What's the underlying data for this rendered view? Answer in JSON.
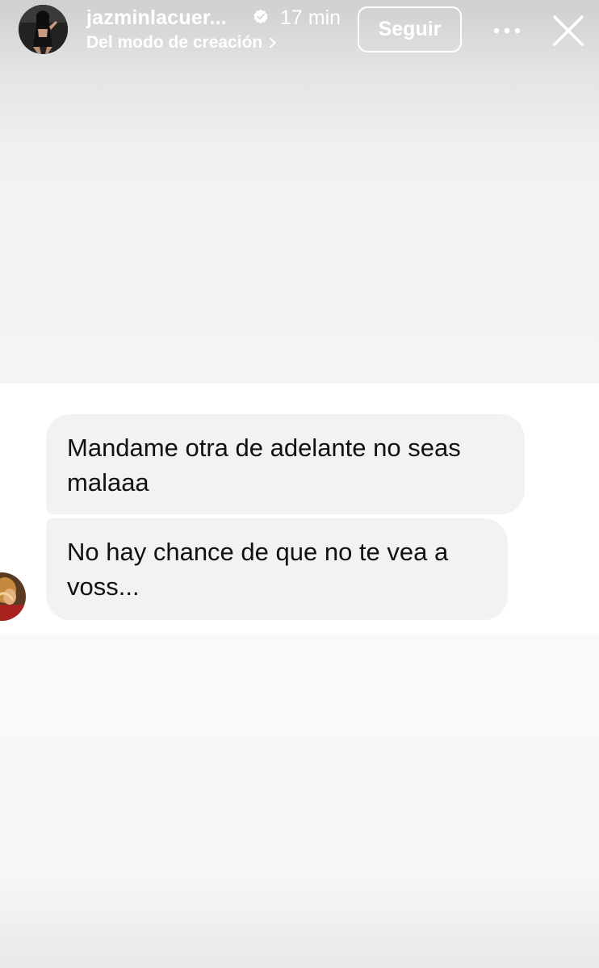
{
  "header": {
    "username": "jazminlacuer...",
    "time": "17 min",
    "subtitle": "Del modo de creación",
    "follow_label": "Seguir",
    "avatar_icon": "profile-photo",
    "verified_icon": "verified-badge-icon",
    "more_icon": "more-options-icon",
    "close_icon": "close-icon"
  },
  "chat": {
    "messages": [
      {
        "text": "Mandame otra de adelante no seas malaaa"
      },
      {
        "text": "No hay chance de que no te vea a voss..."
      }
    ],
    "sender_avatar_icon": "sender-avatar"
  },
  "colors": {
    "bubble_bg": "#f0f2f4",
    "header_text": "#ffffff"
  }
}
